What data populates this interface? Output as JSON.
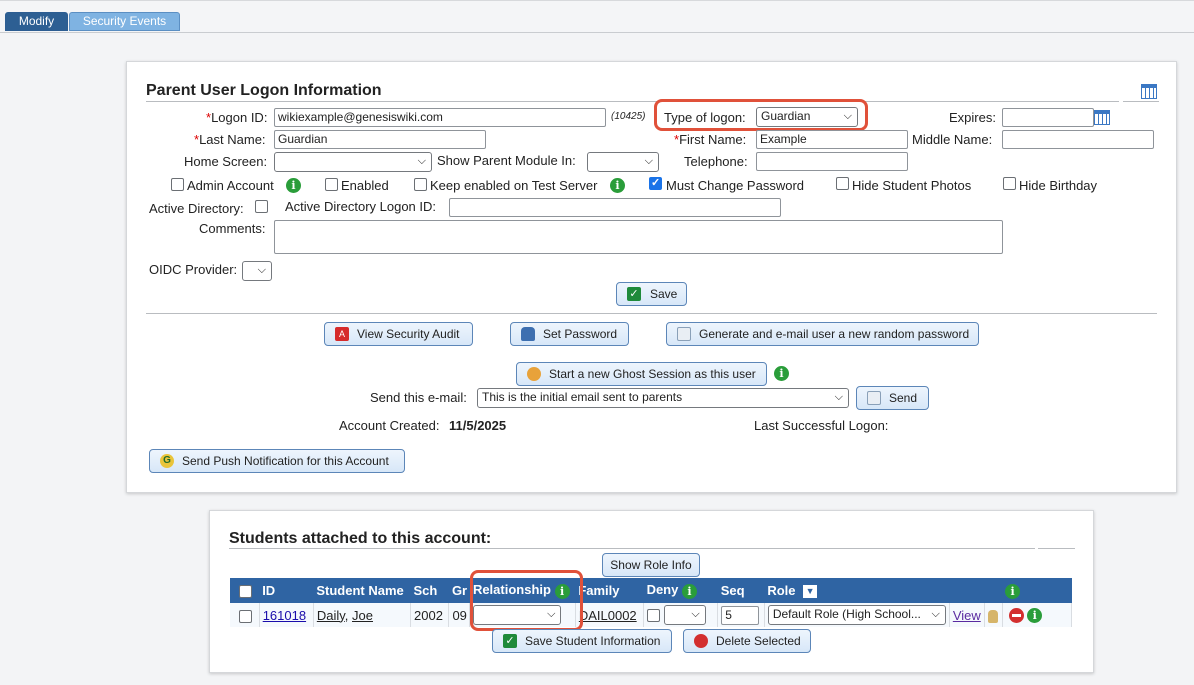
{
  "tabs": [
    {
      "label": "Modify"
    },
    {
      "label": "Security Events"
    }
  ],
  "logon_panel": {
    "title": "Parent User Logon Information",
    "logon_id_label": "Logon ID:",
    "logon_id_value": "wikiexample@genesiswiki.com",
    "logon_id_number": "(10425)",
    "type_of_logon_label": "Type of logon:",
    "type_of_logon_value": "Guardian",
    "expires_label": "Expires:",
    "expires_value": "",
    "last_name_label": "Last Name:",
    "last_name_value": "Guardian",
    "first_name_label": "First Name:",
    "first_name_value": "Example",
    "middle_name_label": "Middle Name:",
    "middle_name_value": "",
    "home_screen_label": "Home Screen:",
    "home_screen_value": "",
    "show_parent_module_label": "Show Parent Module In:",
    "show_parent_module_value": "",
    "telephone_label": "Telephone:",
    "telephone_value": "",
    "checkboxes": [
      {
        "label": "Admin Account",
        "checked": false
      },
      {
        "label": "Enabled",
        "checked": false
      },
      {
        "label": "Keep enabled on Test Server",
        "checked": false
      },
      {
        "label": "Must Change Password",
        "checked": true
      },
      {
        "label": "Hide Student Photos",
        "checked": false
      },
      {
        "label": "Hide Birthday",
        "checked": false
      }
    ],
    "active_directory_label": "Active Directory:",
    "active_directory_logon_label": "Active Directory Logon ID:",
    "active_directory_logon_value": "",
    "comments_label": "Comments:",
    "comments_value": "",
    "oidc_label": "OIDC Provider:",
    "oidc_value": "",
    "save_label": "Save",
    "view_security_audit_label": "View Security Audit",
    "set_password_label": "Set Password",
    "generate_password_label": "Generate and e-mail user a new random password",
    "ghost_session_label": "Start a new Ghost Session as this user",
    "send_email_label": "Send this e-mail:",
    "send_email_value": "This is the initial email sent to parents",
    "send_label": "Send",
    "account_created_label": "Account Created:",
    "account_created_value": "11/5/2025",
    "last_logon_label": "Last Successful Logon:",
    "last_logon_value": "",
    "push_notification_label": "Send Push Notification for this Account"
  },
  "students_panel": {
    "title": "Students attached to this account:",
    "show_role_info_label": "Show Role Info",
    "columns": [
      "ID",
      "Student Name",
      "Sch",
      "Gr",
      "Relationship",
      "Family",
      "Deny",
      "Seq",
      "Role"
    ],
    "rows": [
      {
        "id": "161018",
        "last_name": "Daily",
        "first_name": "Joe",
        "sch": "2002",
        "gr": "09",
        "relationship": "",
        "family": "DAIL0002",
        "deny": false,
        "seq": "5",
        "role": "Default Role (High School...",
        "view_label": "View"
      }
    ],
    "save_students_label": "Save Student Information",
    "delete_selected_label": "Delete Selected"
  },
  "colors": {
    "header_blue": "#2f64a3",
    "highlight_red": "#e0513a",
    "info_green": "#2a9d3a"
  }
}
